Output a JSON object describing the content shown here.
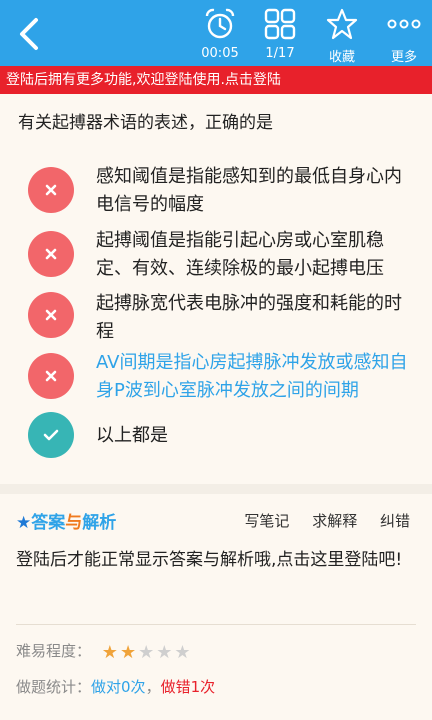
{
  "toolbar": {
    "timer": "00:05",
    "progress": "1/17",
    "favorite": "收藏",
    "more": "更多"
  },
  "login_banner": "登陆后拥有更多功能,欢迎登陆使用.点击登陆",
  "question": "有关起搏器术语的表述，正确的是",
  "options": [
    {
      "text": "感知阈值是指能感知到的最低自身心内电信号的幅度",
      "state": "wrong"
    },
    {
      "text": "起搏阈值是指能引起心房或心室肌稳定、有效、连续除极的最小起搏电压",
      "state": "wrong"
    },
    {
      "text": "起搏脉宽代表电脉冲的强度和耗能的时程",
      "state": "wrong"
    },
    {
      "text": "AV间期是指心房起搏脉冲发放或感知自身P波到心室脉冲发放之间的间期",
      "state": "wrong"
    },
    {
      "text": "以上都是",
      "state": "correct"
    }
  ],
  "answer": {
    "title_star": "★",
    "title_a": "答案",
    "title_yu": "与",
    "title_b": "解析",
    "write_note": "写笔记",
    "ask_explain": "求解释",
    "report_error": "纠错",
    "body": "登陆后才能正常显示答案与解析哦,点击这里登陆吧!"
  },
  "difficulty": {
    "label": "难易程度：",
    "rating": 2,
    "max": 5
  },
  "stats": {
    "label": "做题统计：",
    "correct": "做对0次",
    "sep": "，",
    "wrong": "做错1次"
  },
  "colors": {
    "topbar": "#2fa3e8",
    "banner": "#e8212b",
    "wrong": "#f2666a",
    "correct": "#37b5b5",
    "star_on": "#f0a33a"
  }
}
